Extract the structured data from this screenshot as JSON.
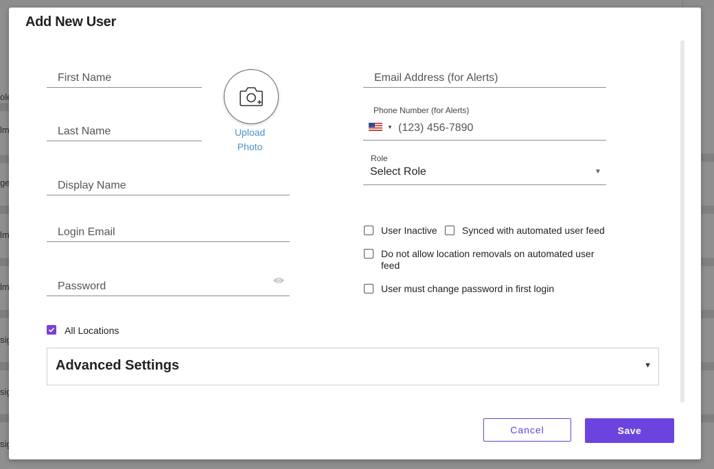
{
  "background": {
    "left_fragments": [
      "ole",
      "lm",
      "ger",
      "lm",
      "lm",
      "sig",
      "sig",
      "sig"
    ]
  },
  "modal": {
    "title": "Add New User",
    "upload_photo": {
      "line1": "Upload",
      "line2": "Photo",
      "icon": "camera-plus-icon"
    },
    "fields": {
      "first_name": "First Name",
      "last_name": "Last Name",
      "display_name": "Display Name",
      "login_email": "Login Email",
      "password": "Password",
      "email_alerts": "Email Address (for Alerts)"
    },
    "phone": {
      "label": "Phone Number (for Alerts)",
      "placeholder": "(123) 456-7890",
      "country_icon": "us-flag-icon"
    },
    "role": {
      "label": "Role",
      "value": "Select Role"
    },
    "checkboxes": {
      "user_inactive": {
        "label": "User Inactive",
        "checked": false
      },
      "synced_feed": {
        "label": "Synced with automated user feed",
        "checked": false
      },
      "no_location_removals": {
        "label": "Do not allow location removals on automated user feed",
        "checked": false
      },
      "must_change_password": {
        "label": "User must change password in first login",
        "checked": false
      },
      "all_locations": {
        "label": "All Locations",
        "checked": true
      }
    },
    "advanced_settings": "Advanced Settings",
    "buttons": {
      "cancel": "Cancel",
      "save": "Save"
    },
    "colors": {
      "accent": "#6b44e0",
      "link": "#4a90c8"
    }
  }
}
